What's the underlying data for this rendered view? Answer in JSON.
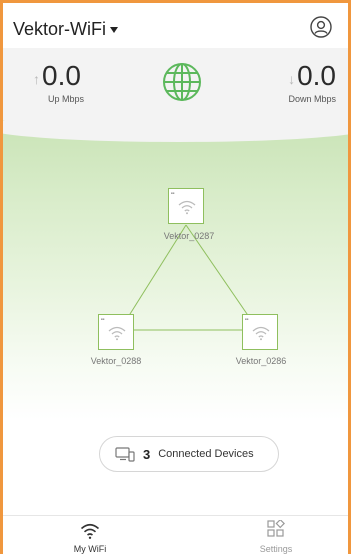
{
  "header": {
    "network_name": "Vektor-WiFi",
    "account_icon": "user-circle-icon"
  },
  "stats": {
    "up_value": "0.0",
    "up_unit": "Up Mbps",
    "down_value": "0.0",
    "down_unit": "Down Mbps",
    "globe_icon": "globe-icon",
    "accent_color": "#5cb85c"
  },
  "mesh": {
    "nodes": [
      {
        "name": "Vektor_0287",
        "icon": "wifi-icon"
      },
      {
        "name": "Vektor_0288",
        "icon": "wifi-icon"
      },
      {
        "name": "Vektor_0286",
        "icon": "wifi-icon"
      }
    ],
    "link_color": "#8fbf5e"
  },
  "devices": {
    "count": "3",
    "label": "Connected Devices",
    "icon": "devices-icon"
  },
  "nav": {
    "items": [
      {
        "label": "My WiFi",
        "icon": "wifi-icon",
        "active": true
      },
      {
        "label": "Settings",
        "icon": "settings-grid-icon",
        "active": false
      }
    ]
  },
  "theme": {
    "frame_color": "#f0973e",
    "mesh_gradient_top": "#c9e3b6"
  }
}
